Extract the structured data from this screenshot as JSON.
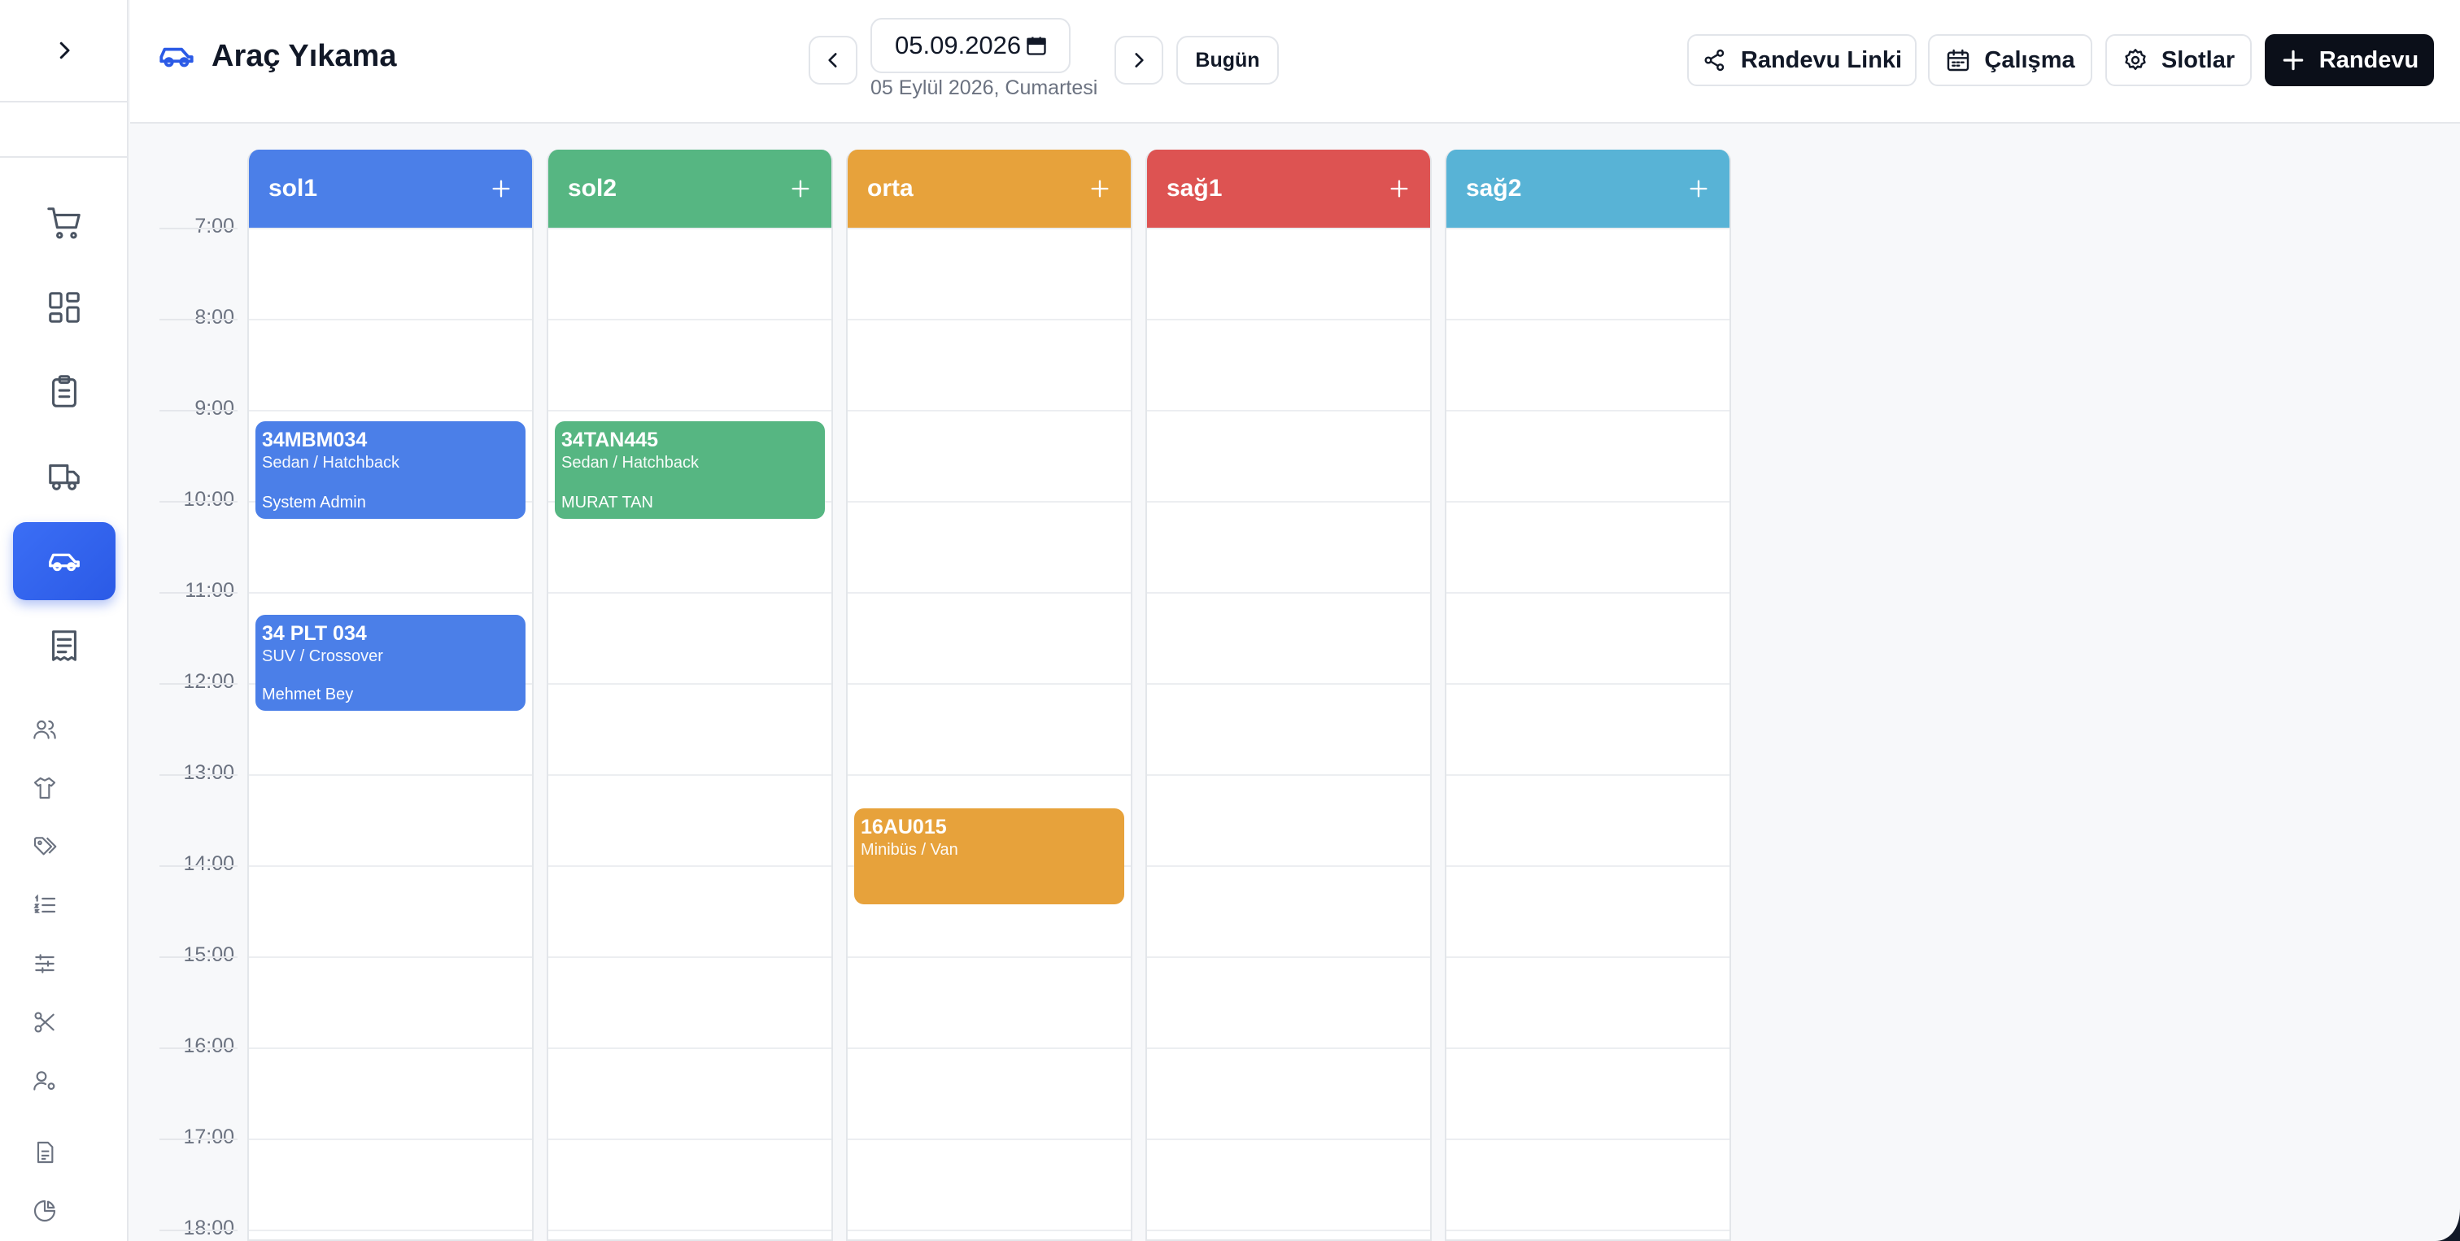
{
  "app": {
    "title": "Araç Yıkama"
  },
  "header": {
    "date_value": "05.09.2026",
    "date_caption": "05 Eylül 2026, Cumartesi",
    "today_label": "Bugün",
    "buttons": {
      "appointment_link": "Randevu Linki",
      "working": "Çalışma",
      "slots": "Slotlar",
      "new_appointment": "Randevu"
    }
  },
  "times": [
    "7:00",
    "8:00",
    "9:00",
    "10:00",
    "11:00",
    "12:00",
    "13:00",
    "14:00",
    "15:00",
    "16:00",
    "17:00",
    "18:00"
  ],
  "columns": [
    {
      "name": "sol1",
      "color": "#4b7fe8"
    },
    {
      "name": "sol2",
      "color": "#56b682"
    },
    {
      "name": "orta",
      "color": "#e7a23b"
    },
    {
      "name": "sağ1",
      "color": "#dd5352"
    },
    {
      "name": "sağ2",
      "color": "#58b3d6"
    }
  ],
  "events": [
    {
      "plate": "34MBM034",
      "vehicle_type": "Sedan / Hatchback",
      "owner": "System Admin"
    },
    {
      "plate": "34 PLT 034",
      "vehicle_type": "SUV / Crossover",
      "owner": "Mehmet Bey"
    },
    {
      "plate": "34TAN445",
      "vehicle_type": "Sedan / Hatchback",
      "owner": "MURAT TAN"
    },
    {
      "plate": "16AU015",
      "vehicle_type": "Minibüs / Van",
      "owner": ""
    }
  ],
  "icons": {
    "sidebar": [
      "chevron-right-icon",
      "cart-icon",
      "dashboard-icon",
      "clipboard-icon",
      "truck-icon",
      "car-icon",
      "receipt-icon",
      "users-icon",
      "shirt-icon",
      "tags-icon",
      "list-icon",
      "sliders-icon",
      "scissors-icon",
      "user-settings-icon",
      "report-icon",
      "pie-chart-icon"
    ],
    "header": [
      "car-icon",
      "chevron-left-icon",
      "calendar-picker-icon",
      "chevron-right-icon",
      "share-icon",
      "calendar-icon",
      "gear-icon",
      "plus-icon"
    ]
  }
}
